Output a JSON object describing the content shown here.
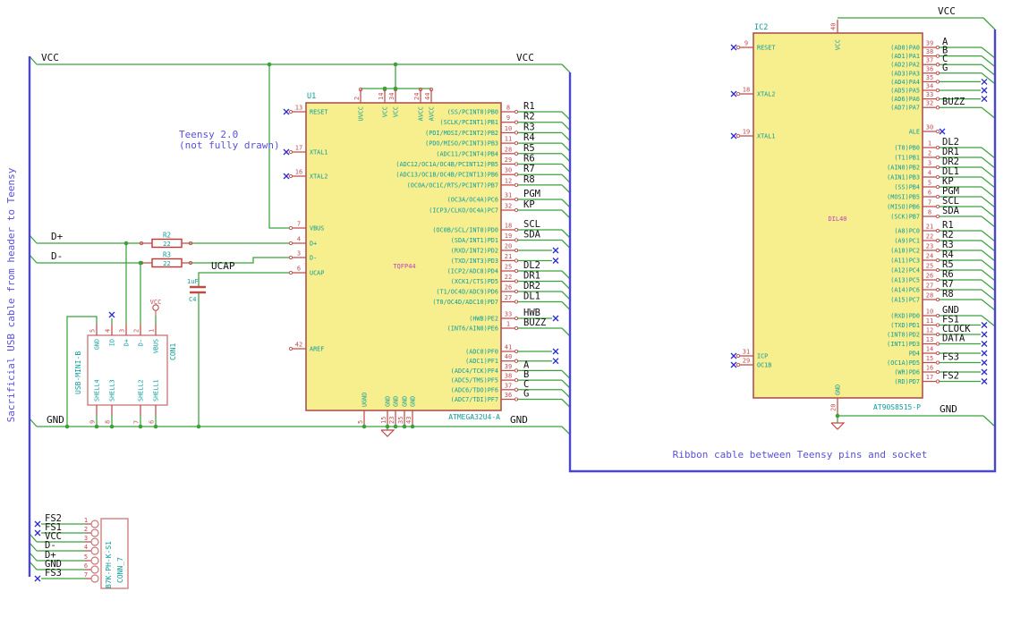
{
  "notes": {
    "sidebar": "Sacrificial USB cable from header to Teensy",
    "teensy": [
      "Teensy 2.0",
      "(not fully drawn)"
    ],
    "ribbon": "Ribbon cable between Teensy pins and socket"
  },
  "colors": {
    "wire": "#3ba13b",
    "bus": "#4b47c9",
    "pin": "#bf4a4a",
    "res": "#c03535",
    "body_fill": "#f7ef8e",
    "body_stroke": "#ad5252",
    "cyan": "#0e9c9c",
    "magenta": "#bf3fbf",
    "nc": "#2b2bd0",
    "label": "#111111",
    "note": "#5b51d8"
  },
  "net_labels": {
    "bus_vcc": "VCC",
    "bus_dp": "D+",
    "bus_dm": "D-",
    "bus_gnd": "GND",
    "u1_vcc": "VCC",
    "u1_gnd": "GND",
    "ucap": "UCAP",
    "ic2_vcc": "VCC",
    "ic2_gnd": "GND",
    "vcc_flag": "VCC"
  },
  "u1": {
    "ref": "U1",
    "value": "ATMEGA32U4-A",
    "footprint": "TQFP44",
    "left_pins": [
      {
        "name": "RESET",
        "num": "13",
        "conn": "nc"
      },
      {
        "name": "XTAL1",
        "num": "17",
        "conn": "nc"
      },
      {
        "name": "XTAL2",
        "num": "16",
        "conn": "nc"
      },
      {
        "name": "VBUS",
        "num": "7",
        "conn": "wire"
      },
      {
        "name": "D+",
        "num": "4",
        "conn": "wire"
      },
      {
        "name": "D-",
        "num": "3",
        "conn": "wire"
      },
      {
        "name": "UCAP",
        "num": "6",
        "conn": "wire"
      },
      {
        "name": "AREF",
        "num": "42",
        "conn": "open"
      }
    ],
    "top_pins": [
      {
        "name": "UVCC",
        "num": "2"
      },
      {
        "name": "VCC",
        "num": "14"
      },
      {
        "name": "VCC",
        "num": "34"
      },
      {
        "name": "AVCC",
        "num": "24"
      },
      {
        "name": "AVCC",
        "num": "44"
      }
    ],
    "bottom_pins": [
      {
        "name": "UGND",
        "num": "5"
      },
      {
        "name": "GND",
        "num": "15"
      },
      {
        "name": "GND",
        "num": "23"
      },
      {
        "name": "GND",
        "num": "35"
      },
      {
        "name": "GND",
        "num": "43"
      }
    ],
    "right_groups": [
      {
        "pins": [
          {
            "name": "(SS/PCINT0)PB0",
            "num": "8",
            "label": "R1",
            "conn": "bus"
          },
          {
            "name": "(SCLK/PCINT1)PB1",
            "num": "9",
            "label": "R2",
            "conn": "bus"
          },
          {
            "name": "(PDI/MOSI/PCINT2)PB2",
            "num": "10",
            "label": "R3",
            "conn": "bus"
          },
          {
            "name": "(PDO/MISO/PCINT3)PB3",
            "num": "11",
            "label": "R4",
            "conn": "bus"
          },
          {
            "name": "(ADC11/PCINT4)PB4",
            "num": "28",
            "label": "R5",
            "conn": "bus"
          },
          {
            "name": "(ADC12/OC1A/OC4B/PCINT12)PB5",
            "num": "29",
            "label": "R6",
            "conn": "bus"
          },
          {
            "name": "(ADC13/OC1B/OC4B/PCINT13)PB6",
            "num": "30",
            "label": "R7",
            "conn": "bus"
          },
          {
            "name": "(OC0A/OC1C/RTS/PCINT7)PB7",
            "num": "12",
            "label": "R8",
            "conn": "bus"
          }
        ]
      },
      {
        "pins": [
          {
            "name": "(OC3A/OC4A)PC6",
            "num": "31",
            "label": "PGM",
            "conn": "bus"
          },
          {
            "name": "(ICP3/CLKO/OC4A)PC7",
            "num": "32",
            "label": "KP",
            "conn": "bus"
          }
        ]
      },
      {
        "pins": [
          {
            "name": "(OC0B/SCL/INT0)PD0",
            "num": "18",
            "label": "SCL",
            "conn": "bus"
          },
          {
            "name": "(SDA/INT1)PD1",
            "num": "19",
            "label": "SDA",
            "conn": "bus"
          },
          {
            "name": "(RXD/INT2)PD2",
            "num": "20",
            "label": "",
            "conn": "nc"
          },
          {
            "name": "(TXD/INT3)PD3",
            "num": "21",
            "label": "",
            "conn": "nc"
          },
          {
            "name": "(ICP2/ADC8)PD4",
            "num": "25",
            "label": "DL2",
            "conn": "bus"
          },
          {
            "name": "(XCK1/CTS)PD5",
            "num": "22",
            "label": "DR1",
            "conn": "bus"
          },
          {
            "name": "(T1/OC4D/ADC9)PD6",
            "num": "26",
            "label": "DR2",
            "conn": "bus"
          },
          {
            "name": "(T0/OC4D/ADC10)PD7",
            "num": "27",
            "label": "DL1",
            "conn": "bus"
          }
        ]
      },
      {
        "pins": [
          {
            "name": "(HWB)PE2",
            "num": "33",
            "label": "HWB",
            "conn": "nc"
          },
          {
            "name": "(INT6/AIN0)PE6",
            "num": "1",
            "label": "BUZZ",
            "conn": "bus"
          }
        ]
      },
      {
        "pins": [
          {
            "name": "(ADC0)PF0",
            "num": "41",
            "label": "",
            "conn": "nc"
          },
          {
            "name": "(ADC1)PF1",
            "num": "40",
            "label": "",
            "conn": "nc"
          },
          {
            "name": "(ADC4/TCK)PF4",
            "num": "39",
            "label": "A",
            "conn": "bus"
          },
          {
            "name": "(ADC5/TMS)PF5",
            "num": "38",
            "label": "B",
            "conn": "bus"
          },
          {
            "name": "(ADC6/TDO)PF6",
            "num": "37",
            "label": "C",
            "conn": "bus"
          },
          {
            "name": "(ADC7/TDI)PF7",
            "num": "36",
            "label": "G",
            "conn": "bus"
          }
        ]
      }
    ]
  },
  "ic2": {
    "ref": "IC2",
    "value": "AT90S8515-P",
    "footprint": "DIL40",
    "left_pins": [
      {
        "name": "RESET",
        "num": "9",
        "conn": "nc"
      },
      {
        "name": "XTAL2",
        "num": "18",
        "conn": "nc"
      },
      {
        "name": "XTAL1",
        "num": "19",
        "conn": "nc"
      },
      {
        "name": "ICP",
        "num": "31",
        "conn": "nc"
      },
      {
        "name": "OC1B",
        "num": "29",
        "conn": "nc"
      }
    ],
    "top_pins": [
      {
        "name": "VCC",
        "num": "40"
      }
    ],
    "bottom_pins": [
      {
        "name": "GND",
        "num": "20"
      }
    ],
    "right_groups": [
      {
        "pins": [
          {
            "name": "(AD0)PA0",
            "num": "39",
            "label": "A",
            "conn": "bus"
          },
          {
            "name": "(AD1)PA1",
            "num": "38",
            "label": "B",
            "conn": "bus"
          },
          {
            "name": "(AD2)PA2",
            "num": "37",
            "label": "C",
            "conn": "bus"
          },
          {
            "name": "(AD3)PA3",
            "num": "36",
            "label": "G",
            "conn": "bus"
          },
          {
            "name": "(AD4)PA4",
            "num": "35",
            "label": "",
            "conn": "nc"
          },
          {
            "name": "(AD5)PA5",
            "num": "34",
            "label": "",
            "conn": "nc"
          },
          {
            "name": "(AD6)PA6",
            "num": "33",
            "label": "",
            "conn": "nc"
          },
          {
            "name": "(AD7)PA7",
            "num": "32",
            "label": "BUZZ",
            "conn": "bus"
          }
        ]
      },
      {
        "pins": [
          {
            "name": "ALE",
            "num": "30",
            "label": "",
            "conn": "nc-short"
          }
        ]
      },
      {
        "pins": [
          {
            "name": "(T0)PB0",
            "num": "1",
            "label": "DL2",
            "conn": "bus"
          },
          {
            "name": "(T1)PB1",
            "num": "2",
            "label": "DR1",
            "conn": "bus"
          },
          {
            "name": "(AIN0)PB2",
            "num": "3",
            "label": "DR2",
            "conn": "bus"
          },
          {
            "name": "(AIN1)PB3",
            "num": "4",
            "label": "DL1",
            "conn": "bus"
          },
          {
            "name": "(SS)PB4",
            "num": "5",
            "label": "KP",
            "conn": "bus"
          },
          {
            "name": "(MOSI)PB5",
            "num": "6",
            "label": "PGM",
            "conn": "bus"
          },
          {
            "name": "(MISO)PB6",
            "num": "7",
            "label": "SCL",
            "conn": "bus"
          },
          {
            "name": "(SCK)PB7",
            "num": "8",
            "label": "SDA",
            "conn": "bus"
          }
        ]
      },
      {
        "pins": [
          {
            "name": "(A8)PC0",
            "num": "21",
            "label": "R1",
            "conn": "bus"
          },
          {
            "name": "(A9)PC1",
            "num": "22",
            "label": "R2",
            "conn": "bus"
          },
          {
            "name": "(A10)PC2",
            "num": "23",
            "label": "R3",
            "conn": "bus"
          },
          {
            "name": "(A11)PC3",
            "num": "24",
            "label": "R4",
            "conn": "bus"
          },
          {
            "name": "(A12)PC4",
            "num": "25",
            "label": "R5",
            "conn": "bus"
          },
          {
            "name": "(A13)PC5",
            "num": "26",
            "label": "R6",
            "conn": "bus"
          },
          {
            "name": "(A14)PC6",
            "num": "27",
            "label": "R7",
            "conn": "bus"
          },
          {
            "name": "(A15)PC7",
            "num": "28",
            "label": "R8",
            "conn": "bus"
          }
        ]
      },
      {
        "pins": [
          {
            "name": "(RXD)PD0",
            "num": "10",
            "label": "GND",
            "conn": "bus"
          },
          {
            "name": "(TXD)PD1",
            "num": "11",
            "label": "FS1",
            "conn": "nc"
          },
          {
            "name": "(INT0)PD2",
            "num": "12",
            "label": "CLOCK",
            "conn": "nc"
          },
          {
            "name": "(INT1)PD3",
            "num": "13",
            "label": "DATA",
            "conn": "nc"
          },
          {
            "name": "PD4",
            "num": "14",
            "label": "",
            "conn": "nc"
          },
          {
            "name": "(OC1A)PD5",
            "num": "15",
            "label": "FS3",
            "conn": "nc"
          },
          {
            "name": "(WR)PD6",
            "num": "16",
            "label": "",
            "conn": "nc"
          },
          {
            "name": "(RD)PD7",
            "num": "17",
            "label": "FS2",
            "conn": "nc"
          }
        ]
      }
    ]
  },
  "con1": {
    "ref": "CON1",
    "value": "USB-MINI-B",
    "top_pins": [
      {
        "name": "GND",
        "num": "5",
        "conn": "wire"
      },
      {
        "name": "ID",
        "num": "4",
        "conn": "nc"
      },
      {
        "name": "D+",
        "num": "3",
        "conn": "wire"
      },
      {
        "name": "D-",
        "num": "2",
        "conn": "wire"
      },
      {
        "name": "VBUS",
        "num": "1",
        "conn": "vcc"
      }
    ],
    "bottom_pins": [
      {
        "name": "SHELL4",
        "num": "9"
      },
      {
        "name": "SHELL3",
        "num": "8"
      },
      {
        "name": "SHELL2",
        "num": "7"
      },
      {
        "name": "SHELL1",
        "num": "6"
      }
    ]
  },
  "conn7": {
    "ref": "CONN_7",
    "value": "B7K-PH-K-S1",
    "pins": [
      {
        "num": "1",
        "label": "FS2",
        "conn": "nc"
      },
      {
        "num": "2",
        "label": "FS1",
        "conn": "nc"
      },
      {
        "num": "3",
        "label": "VCC",
        "conn": "bus"
      },
      {
        "num": "4",
        "label": "D-",
        "conn": "bus"
      },
      {
        "num": "5",
        "label": "D+",
        "conn": "bus"
      },
      {
        "num": "6",
        "label": "GND",
        "conn": "bus"
      },
      {
        "num": "7",
        "label": "FS3",
        "conn": "nc"
      }
    ]
  },
  "r2": {
    "ref": "R2",
    "value": "22"
  },
  "r3": {
    "ref": "R3",
    "value": "22"
  },
  "c4": {
    "ref": "C4",
    "value": "1uF"
  }
}
